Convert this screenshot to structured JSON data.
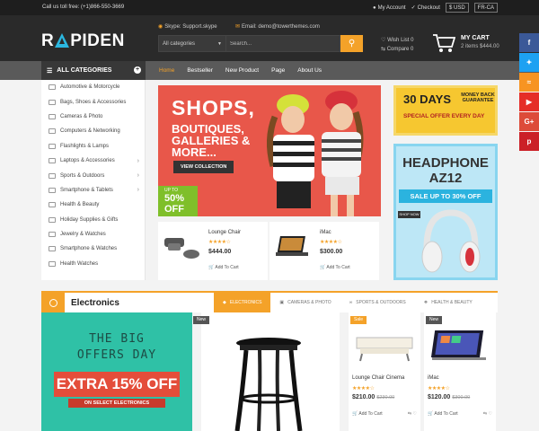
{
  "topbar": {
    "toll": "Call us toll free: (+1)866-550-3669",
    "account": "My Account",
    "checkout": "Checkout",
    "currency": "$ USD",
    "language": "FR-CA"
  },
  "header": {
    "logo": "APIDEN",
    "skype_label": "Skype: Support.skype",
    "email_label": "Email: demo@towerthemes.com",
    "search_category": "All categories",
    "search_placeholder": "Search...",
    "wishlist": "Wish List 0",
    "compare": "Compare 0",
    "cart_title": "MY CART",
    "cart_sub": "2 items $444.00"
  },
  "nav": {
    "all_categories": "ALL CATEGORIES",
    "links": [
      "Home",
      "Bestseller",
      "New Product",
      "Page",
      "About Us"
    ]
  },
  "sidebar": {
    "items": [
      "Automotive & Motorcycle",
      "Bags, Shoes & Accessories",
      "Cameras & Photo",
      "Computers & Networking",
      "Flashlights & Lamps",
      "Laptops & Accessories",
      "Sports & Outdoors",
      "Smartphone & Tablets",
      "Health & Beauty",
      "Holiday Supplies & Gifts",
      "Jewelry & Watches",
      "Smartphone & Watches",
      "Health Watches"
    ]
  },
  "hero": {
    "title": "SHOPS,",
    "subtitle": "BOUTIQUES, GALLERIES & MORE...",
    "button": "VIEW COLLECTION",
    "badge_up": "UP TO",
    "badge_pct": "50%",
    "badge_off": "OFF"
  },
  "ad_days": {
    "title": "30 DAYS",
    "guarantee": "MONEY BACK GUARANTEE",
    "special": "SPECIAL OFFER EVERY DAY"
  },
  "ad_headphone": {
    "line1": "HEADPHONE",
    "line2": "AZ12",
    "sale": "SALE UP TO 30% OFF",
    "shop": "SHOP NOW"
  },
  "mini_products": [
    {
      "title": "Lounge Chair",
      "stars": "★★★★☆",
      "price": "$444.00",
      "add": "Add To Cart"
    },
    {
      "title": "iMac",
      "stars": "★★★★☆",
      "price": "$300.00",
      "add": "Add To Cart"
    }
  ],
  "electronics": {
    "title": "Electronics",
    "tabs": [
      "ELECTRONICS",
      "CAMERAS & PHOTO",
      "SPORTS & OUTDOORS",
      "HEALTH & BEAUTY"
    ]
  },
  "offers": {
    "line1": "THE BIG",
    "line2": "OFFERS DAY",
    "ribbon": "EXTRA 15% OFF",
    "select": "ON SELECT ELECTRONICS"
  },
  "products": [
    {
      "tag": "New",
      "title": "",
      "stars": "",
      "price": "",
      "old": "",
      "add": ""
    },
    {
      "tag": "Sale",
      "title": "Lounge Chair Cinema",
      "stars": "★★★★☆",
      "price": "$210.00",
      "old": "$230.00",
      "add": "Add To Cart"
    },
    {
      "tag": "New",
      "title": "iMac",
      "stars": "★★★★☆",
      "price": "$120.00",
      "old": "$300.00",
      "add": "Add To Cart"
    }
  ],
  "social": [
    "f",
    "t",
    "rss",
    "yt",
    "G+",
    "p"
  ],
  "colors": {
    "accent": "#f4a229",
    "dark": "#2a2a2a",
    "brand_blue": "#2bb7e0"
  }
}
